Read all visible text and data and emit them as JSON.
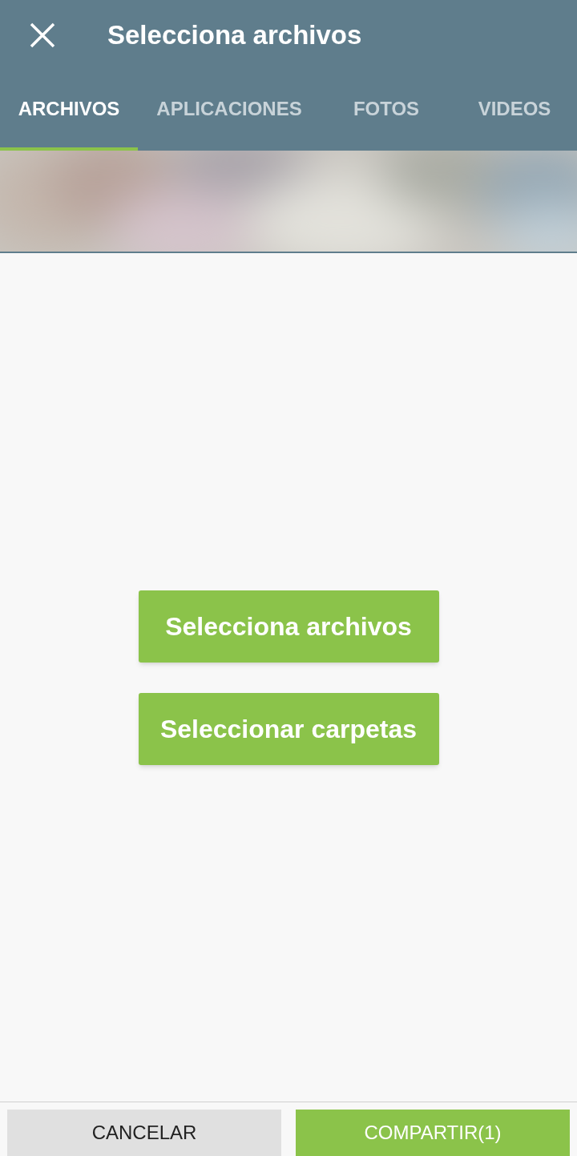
{
  "header": {
    "title": "Selecciona archivos"
  },
  "tabs": [
    {
      "label": "ARCHIVOS",
      "selected": true
    },
    {
      "label": "APLICACIONES",
      "selected": false
    },
    {
      "label": "FOTOS",
      "selected": false
    },
    {
      "label": "VIDEOS",
      "selected": false
    }
  ],
  "actions": [
    "Selecciona archivos",
    "Seleccionar carpetas"
  ],
  "footer": {
    "cancel": "CANCELAR",
    "confirm": "COMPARTIR(1)"
  }
}
